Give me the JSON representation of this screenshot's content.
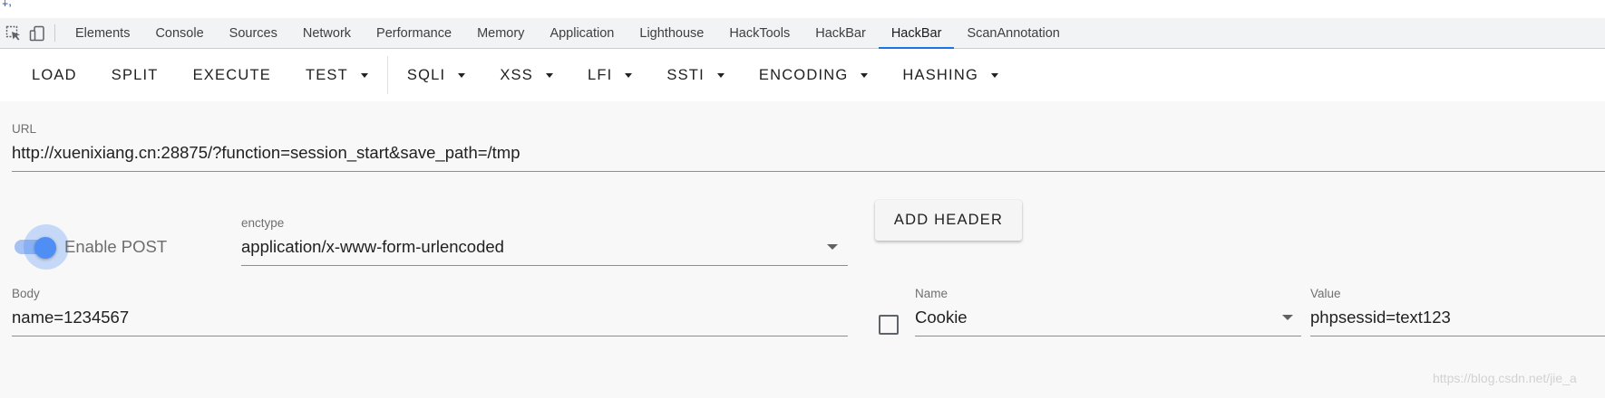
{
  "top_fragment": "‡,",
  "devtools": {
    "icons": [
      "inspect-element-icon",
      "device-toolbar-icon"
    ],
    "tabs": [
      {
        "label": "Elements",
        "active": false
      },
      {
        "label": "Console",
        "active": false
      },
      {
        "label": "Sources",
        "active": false
      },
      {
        "label": "Network",
        "active": false
      },
      {
        "label": "Performance",
        "active": false
      },
      {
        "label": "Memory",
        "active": false
      },
      {
        "label": "Application",
        "active": false
      },
      {
        "label": "Lighthouse",
        "active": false
      },
      {
        "label": "HackTools",
        "active": false
      },
      {
        "label": "HackBar",
        "active": false
      },
      {
        "label": "HackBar",
        "active": true
      },
      {
        "label": "ScanAnnotation",
        "active": false
      }
    ],
    "active_tab_color": "#1a73e8"
  },
  "hackbar": {
    "toolbar": {
      "load": "LOAD",
      "split": "SPLIT",
      "execute": "EXECUTE",
      "test": "TEST",
      "sqli": "SQLI",
      "xss": "XSS",
      "lfi": "LFI",
      "ssti": "SSTI",
      "encoding": "ENCODING",
      "hashing": "HASHING"
    },
    "url": {
      "label": "URL",
      "value": "http://xuenixiang.cn:28875/?function=session_start&save_path=/tmp"
    },
    "post": {
      "toggle_label": "Enable POST",
      "enabled": true,
      "toggle_color": "#4f8ef5"
    },
    "enctype": {
      "label": "enctype",
      "value": "application/x-www-form-urlencoded"
    },
    "add_header": "ADD HEADER",
    "body": {
      "label": "Body",
      "value": "name=1234567"
    },
    "header": {
      "checked": false,
      "name_label": "Name",
      "name_value": "Cookie",
      "value_label": "Value",
      "value_value": "phpsessid=text123"
    }
  },
  "watermark": "https://blog.csdn.net/jie_a"
}
